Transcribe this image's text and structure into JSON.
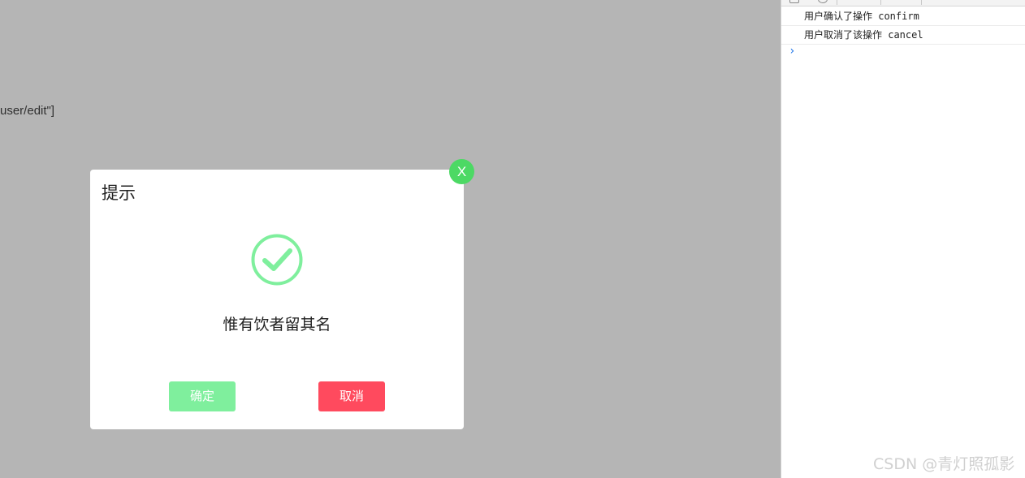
{
  "page": {
    "route_text": "user/edit\"]"
  },
  "modal": {
    "title": "提示",
    "close_label": "X",
    "message": "惟有饮者留其名",
    "confirm_label": "确定",
    "cancel_label": "取消",
    "icon": "check-circle-icon",
    "colors": {
      "close": "#4cd964",
      "confirm": "#7fef9d",
      "cancel": "#ff4a5e",
      "icon": "#7fef9d"
    }
  },
  "console": {
    "logs": [
      "用户确认了操作 confirm",
      "用户取消了该操作 cancel"
    ],
    "prompt": "›"
  },
  "watermark": "CSDN @青灯照孤影"
}
